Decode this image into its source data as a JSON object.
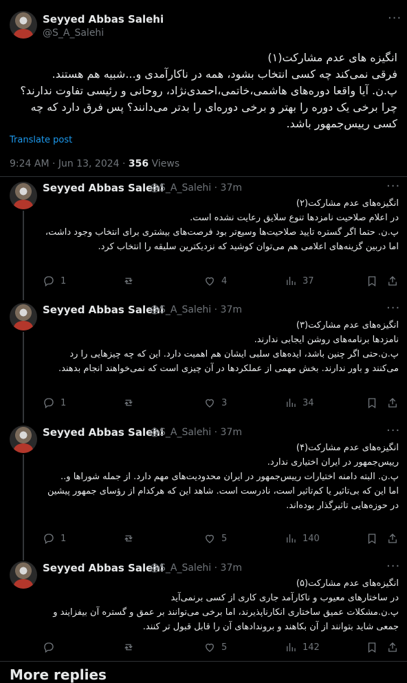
{
  "main": {
    "author_name": "Seyyed Abbas Salehi",
    "author_handle": "@S_A_Salehi",
    "text": "انگیزه های عدم مشارکت(۱)\nفرقی نمی‌کند چه کسی انتخاب بشود، همه در ناکارآمدی و...شبیه هم هستند.\nپ.ن. آیا واقعا دوره‌های هاشمی،خاتمی،احمدی‌نژاد، روحانی و رئیسی تفاوت ندارند؟\nچرا برخی یک دوره را بهتر و برخی دوره‌ای را بدتر می‌دانند؟ پس فرق دارد که چه کسی رییس‌جمهور باشد.",
    "translate_label": "Translate post",
    "timestamp": "9:24 AM · Jun 13, 2024 · ",
    "views_count": "356",
    "views_label": " Views"
  },
  "replies": [
    {
      "author_name": "Seyyed Abbas Salehi",
      "author_handle": "@S_A_Salehi · 37m",
      "text": "انگیزه‌های عدم مشارکت(۲)\nدر اعلام صلاحیت نامزدها  تنوع سلایق رعایت نشده است.\nپ.ن. حتما اگر گستره تایید صلاحیت‌ها وسیع‌تر بود فرصت‌های بیشتری برای انتخاب وجود داشت، اما دربین گزینه‌های اعلامی هم می‌توان کوشید که نزدیکترین سلیقه را انتخاب کرد.",
      "replies": "1",
      "reposts": "",
      "likes": "4",
      "views": "37"
    },
    {
      "author_name": "Seyyed Abbas Salehi",
      "author_handle": "@S_A_Salehi · 37m",
      "text": "انگیزه‌های عدم مشارکت(۳)\nنامزدها برنامه‌های روشن ایجابی ندارند.\nپ.ن.حتی اگر چنین باشد، ایده‌های سلبی ایشان هم اهمیت دارد. این که چه چیزهایی را رد می‌کنند و باور ندارند. بخش مهمی از عملکردها در آن چیزی است که نمی‌خواهند انجام بدهند.",
      "replies": "1",
      "reposts": "",
      "likes": "3",
      "views": "34"
    },
    {
      "author_name": "Seyyed Abbas Salehi",
      "author_handle": "@S_A_Salehi · 37m",
      "text": "انگیزه‌های عدم مشارکت(۴)\nرییس‌جمهور در ایران اختیاری ندارد.\nپ.ن. البته دامنه اختیارات رییس‌جمهور در ایران محدودیت‌های مهم دارد. از جمله شوراها و..\nاما این که بی‌تاثیر یا کم‌تاثیر است، نادرست است. شاهد این که هرکدام از رؤسای جمهور پیشین در حوزه‌هایی تاثیرگذار بوده‌اند.",
      "replies": "1",
      "reposts": "",
      "likes": "5",
      "views": "140"
    },
    {
      "author_name": "Seyyed Abbas Salehi",
      "author_handle": "@S_A_Salehi · 37m",
      "text": "انگیزه‌های عدم مشارکت(۵)\nدر ساختارهای معیوب و ناکارآمد جاری کاری از کسی برنمی‌آید\nپ.ن.مشکلات عمیق ساختاری انکارناپذیرند، اما برخی می‌توانند بر عمق و گستره آن بیفزایند و جمعی شاید بتوانند از آن بکاهند و بروندادهای آن را قابل قبول تر کنند.",
      "replies": "",
      "reposts": "",
      "likes": "5",
      "views": "142"
    }
  ],
  "footer": {
    "more_replies": "More replies"
  },
  "icons": [
    "more-icon",
    "reply-icon",
    "repost-icon",
    "like-icon",
    "views-icon",
    "bookmark-icon",
    "share-icon",
    "avatar"
  ],
  "colors": {
    "background": "#000000",
    "text": "#e7e9ea",
    "muted": "#71767b",
    "link": "#1d9bf0",
    "divider": "#2f3336"
  }
}
